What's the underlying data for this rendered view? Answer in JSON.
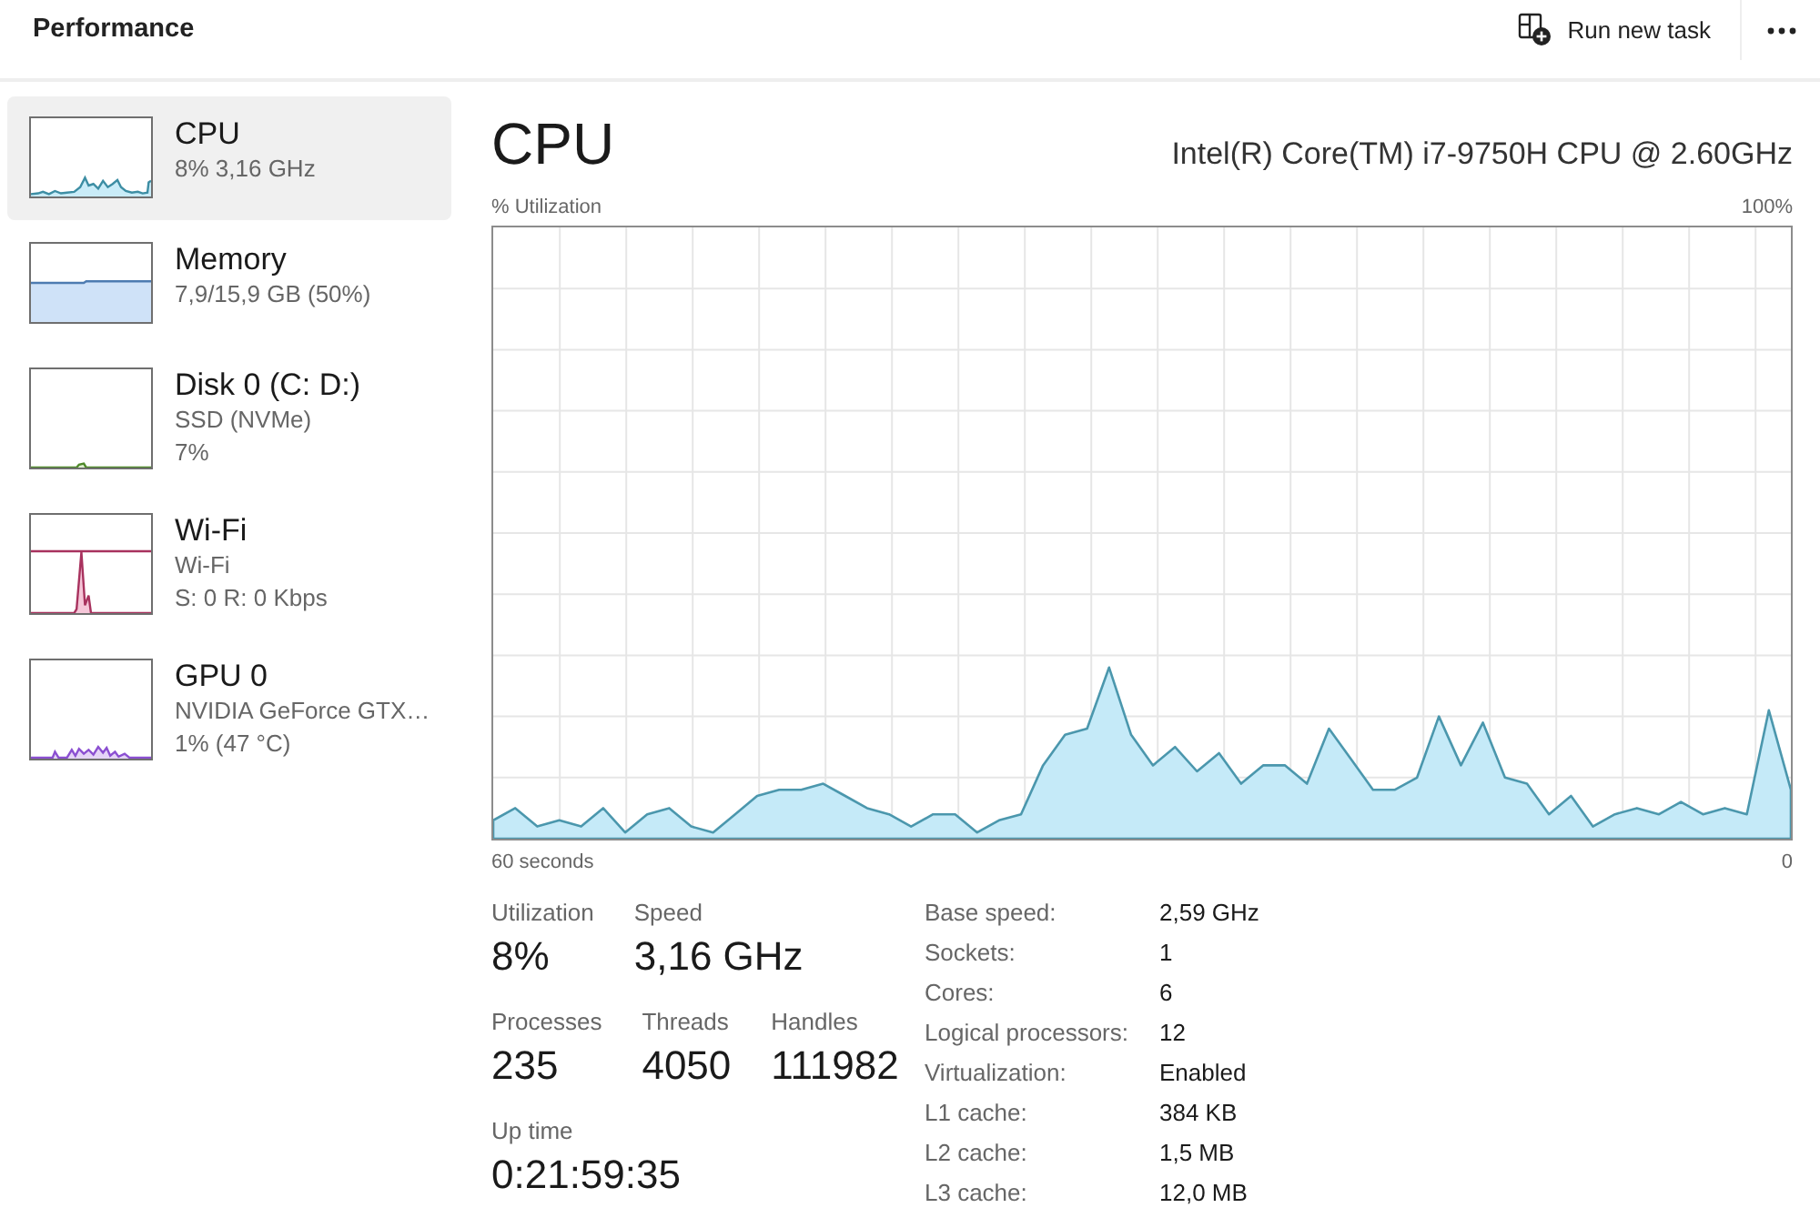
{
  "header": {
    "title": "Performance",
    "run_task_button": "Run new task"
  },
  "sidebar": {
    "items": [
      {
        "kind": "cpu",
        "title": "CPU",
        "details": [
          "8% 3,16 GHz"
        ],
        "selected": true
      },
      {
        "kind": "memory",
        "title": "Memory",
        "details": [
          "7,9/15,9 GB (50%)"
        ],
        "selected": false
      },
      {
        "kind": "disk",
        "title": "Disk 0 (C: D:)",
        "details": [
          "SSD (NVMe)",
          "7%"
        ],
        "selected": false
      },
      {
        "kind": "network",
        "title": "Wi-Fi",
        "details": [
          "Wi-Fi",
          "S: 0 R: 0 Kbps"
        ],
        "selected": false
      },
      {
        "kind": "gpu",
        "title": "GPU 0",
        "details": [
          "NVIDIA GeForce GTX…",
          "1% (47 °C)"
        ],
        "selected": false
      }
    ]
  },
  "detail": {
    "title": "CPU",
    "processor": "Intel(R) Core(TM) i7-9750H CPU @ 2.60GHz",
    "graph": {
      "axis_label": "% Utilization",
      "scale_label": "100%",
      "start_label": "60 seconds",
      "end_label": "0"
    },
    "stat_groups": [
      {
        "stats": [
          {
            "label": "Utilization",
            "value": "8%"
          },
          {
            "label": "Speed",
            "value": "3,16 GHz"
          }
        ]
      },
      {
        "stats": [
          {
            "label": "Processes",
            "value": "235"
          },
          {
            "label": "Threads",
            "value": "4050"
          },
          {
            "label": "Handles",
            "value": "111982"
          }
        ]
      },
      {
        "stats": [
          {
            "label": "Up time",
            "value": "0:21:59:35"
          }
        ]
      }
    ],
    "specs": [
      {
        "label": "Base speed:",
        "value": "2,59 GHz"
      },
      {
        "label": "Sockets:",
        "value": "1"
      },
      {
        "label": "Cores:",
        "value": "6"
      },
      {
        "label": "Logical processors:",
        "value": "12"
      },
      {
        "label": "Virtualization:",
        "value": "Enabled"
      },
      {
        "label": "L1 cache:",
        "value": "384 KB"
      },
      {
        "label": "L2 cache:",
        "value": "1,5 MB"
      },
      {
        "label": "L3 cache:",
        "value": "12,0 MB"
      }
    ]
  }
}
